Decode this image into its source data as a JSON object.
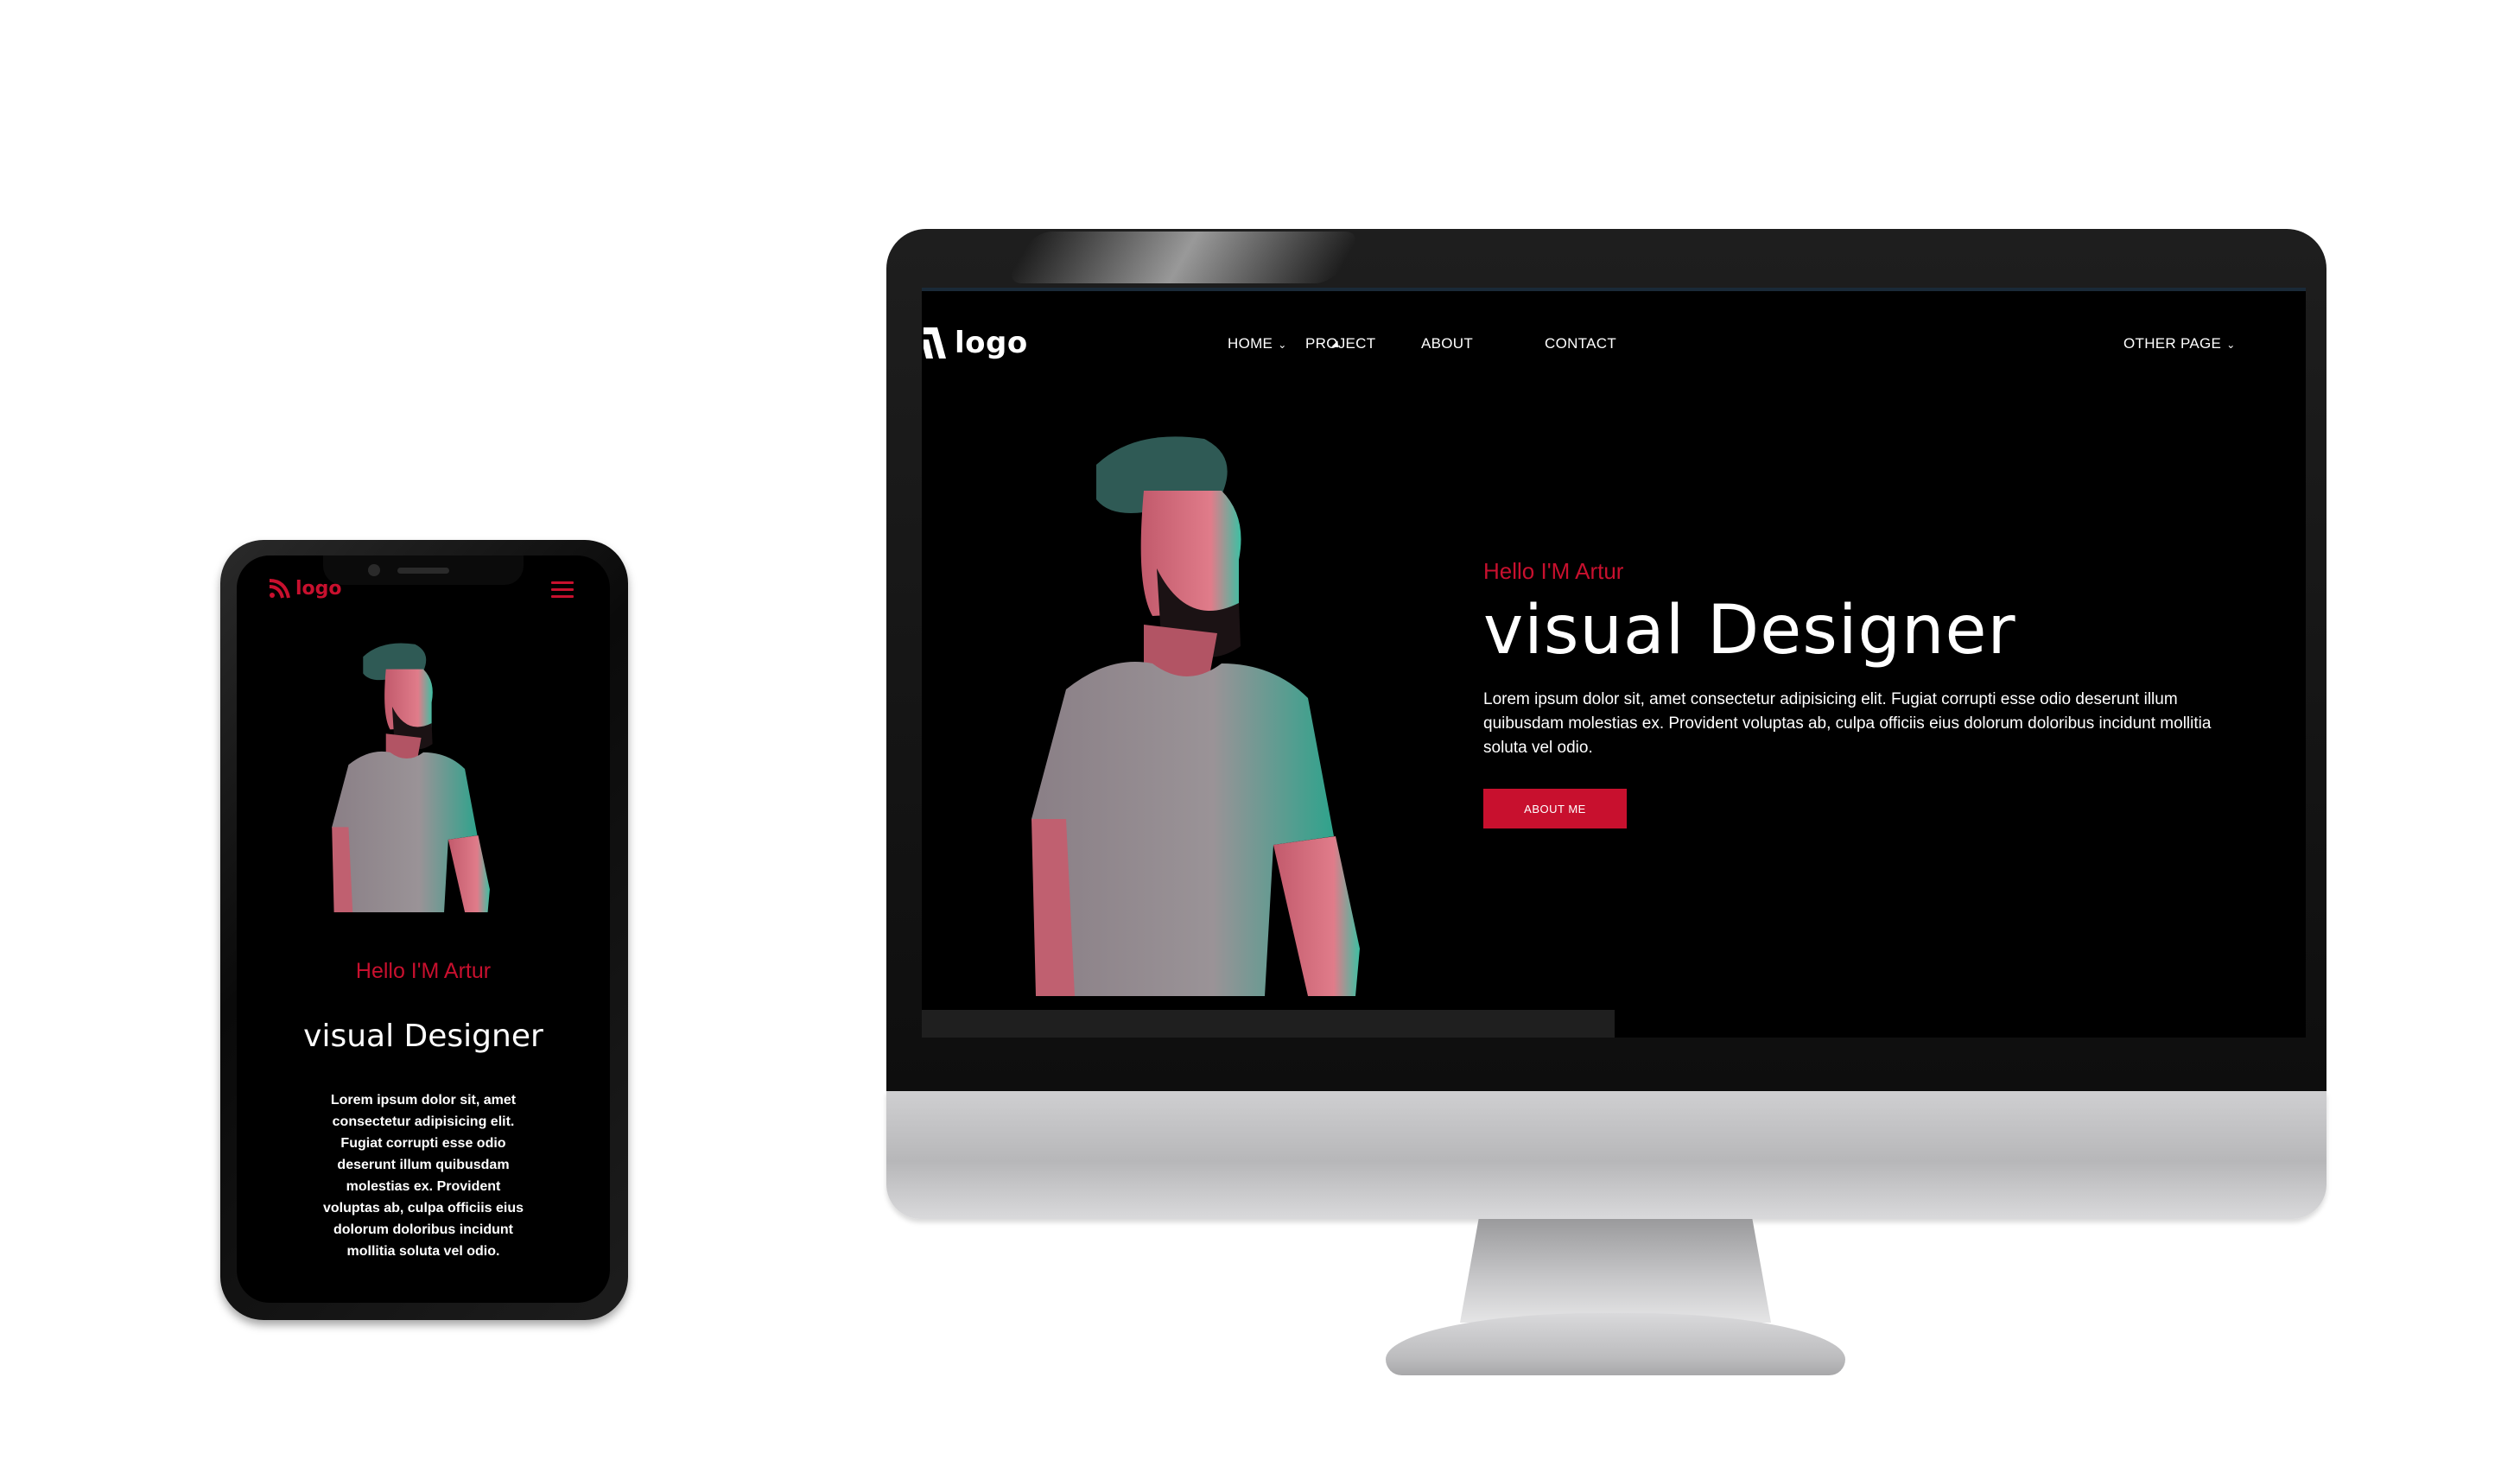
{
  "site": {
    "logo_text": "logo",
    "nav": [
      {
        "label": "HOME",
        "has_dropdown": true
      },
      {
        "label": "PROJECT",
        "has_dropdown": false
      },
      {
        "label": "ABOUT",
        "has_dropdown": false
      },
      {
        "label": "CONTACT",
        "has_dropdown": false
      },
      {
        "label": "OTHER PAGE",
        "has_dropdown": true
      }
    ],
    "chevron": "⌄",
    "hero": {
      "greeting": "Hello I'M Artur",
      "title": "visual Designer",
      "description": "Lorem ipsum dolor sit, amet consectetur adipisicing elit. Fugiat corrupti esse odio deserunt illum quibusdam molestias ex. Provident voluptas ab, culpa officiis eius dolorum doloribus incidunt mollitia soluta vel odio.",
      "button_label": "ABOUT ME"
    }
  },
  "colors": {
    "accent": "#c8102e",
    "background": "#000000",
    "text": "#ffffff"
  },
  "icons": {
    "logo": "wifi-signal-icon",
    "menu": "hamburger-menu-icon",
    "dropdown": "chevron-down-icon"
  }
}
